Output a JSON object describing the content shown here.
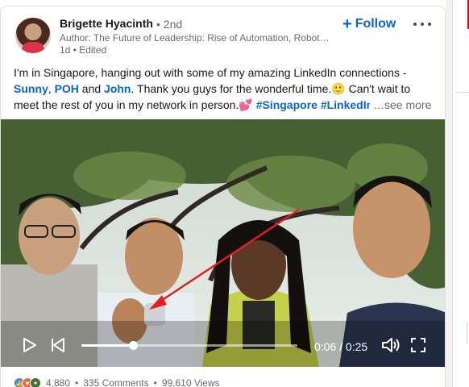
{
  "post": {
    "author": {
      "name": "Brigette Hyacinth",
      "degree": "• 2nd",
      "headline": "Author: The Future of Leadership: Rise of Automation, Robotics and Artificial Intelligence",
      "meta": "1d • Edited"
    },
    "actions": {
      "follow_label": "Follow",
      "more_icon": "ellipsis-icon"
    },
    "text": {
      "line1": "I'm in Singapore, hanging out with some of my amazing LinkedIn connections -",
      "mention1": "Sunny",
      "sep1": ", ",
      "mention2": "POH",
      "sep2": " and ",
      "mention3": "John",
      "line2_rest": ". Thank you guys for the wonderful time.🙂 Can't wait to",
      "line3": "meet the rest of you in my network in person.💕",
      "hashtag1": "#Singapore",
      "hashtag2": "#LinkedIn",
      "see_more": "…see more"
    },
    "video": {
      "current_time": "0:06",
      "duration": "0:25",
      "time_sep": " / ",
      "progress": 0.24
    },
    "social": {
      "reaction_count": "4,880",
      "comments": "335 Comments",
      "views": "99,610 Views",
      "dot": "•"
    }
  },
  "colors": {
    "link": "#0a66c2",
    "muted": "rgba(0,0,0,0.6)"
  }
}
